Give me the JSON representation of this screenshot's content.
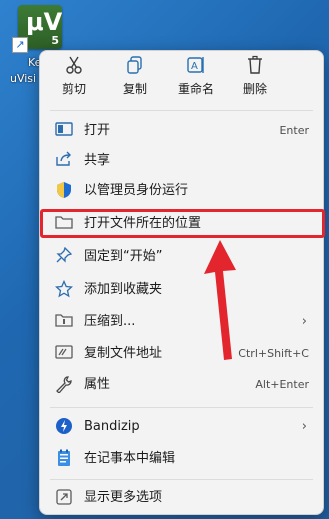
{
  "desktop_icon": {
    "tile_text": "μV",
    "tile_version": "5",
    "label_line1": "Ke",
    "label_line2": "uVisi"
  },
  "toolbar": {
    "cut_label": "剪切",
    "copy_label": "复制",
    "rename_label": "重命名",
    "delete_label": "删除"
  },
  "menu": {
    "open": {
      "label": "打开",
      "shortcut": "Enter"
    },
    "share": {
      "label": "共享"
    },
    "run_as_admin": {
      "label": "以管理员身份运行"
    },
    "open_location": {
      "label": "打开文件所在的位置"
    },
    "pin_start": {
      "label": "固定到“开始”"
    },
    "add_favorites": {
      "label": "添加到收藏夹"
    },
    "compress": {
      "label": "压缩到..."
    },
    "copy_path": {
      "label": "复制文件地址",
      "shortcut": "Ctrl+Shift+C"
    },
    "properties": {
      "label": "属性",
      "shortcut": "Alt+Enter"
    },
    "bandizip": {
      "label": "Bandizip"
    },
    "edit_notepad": {
      "label": "在记事本中编辑"
    },
    "more_options": {
      "label": "显示更多选项"
    }
  },
  "colors": {
    "accent_icon": "#2c6cb0",
    "highlight_red": "#e3262e",
    "menu_bg": "#f3f3f3",
    "desktop_bg": "#1f68b1"
  },
  "icons": {
    "cut": "scissors-icon",
    "copy": "copy-icon",
    "rename": "rename-icon",
    "delete": "trash-icon",
    "open": "open-app-icon",
    "share": "share-icon",
    "admin": "shield-icon",
    "location": "folder-icon",
    "pin": "pin-icon",
    "favorite": "star-icon",
    "compress": "zip-icon",
    "copy_path": "copy-path-icon",
    "properties": "wrench-icon",
    "bandizip": "bandizip-icon",
    "notepad": "notepad-icon",
    "more": "more-options-icon"
  }
}
